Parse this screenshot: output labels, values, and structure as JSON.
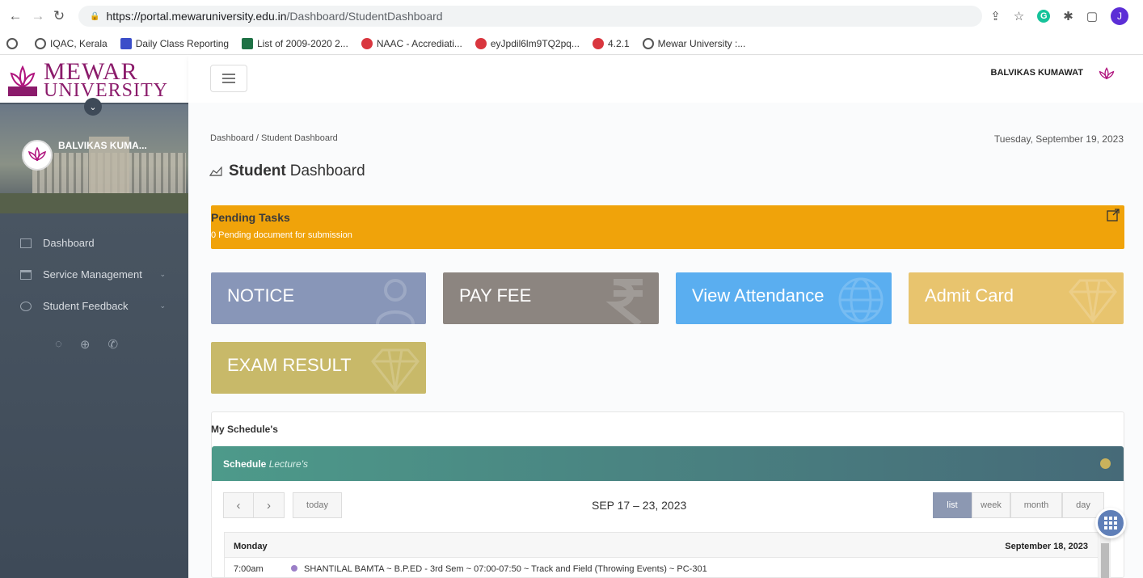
{
  "browser": {
    "url_host": "https://portal.mewaruniversity.edu.in",
    "url_path": "/Dashboard/StudentDashboard",
    "profile_initial": "J"
  },
  "bookmarks": [
    {
      "label": "IQAC, Kerala",
      "icon": "globe-icon"
    },
    {
      "label": "Daily Class Reporting",
      "icon": "list-icon"
    },
    {
      "label": "List of 2009-2020 2...",
      "icon": "excel-icon"
    },
    {
      "label": "NAAC - Accrediati...",
      "icon": "red-logo-icon"
    },
    {
      "label": "eyJpdil6lm9TQ2pq...",
      "icon": "red-logo-icon"
    },
    {
      "label": "4.2.1",
      "icon": "red-logo-icon"
    },
    {
      "label": "Mewar University :...",
      "icon": "globe-icon"
    }
  ],
  "sidebar": {
    "logo_line1": "MEWAR",
    "logo_line2": "UNIVERSITY",
    "user_name": "BALVIKAS KUMA...",
    "items": [
      {
        "label": "Dashboard"
      },
      {
        "label": "Service Management"
      },
      {
        "label": "Student Feedback"
      }
    ]
  },
  "header": {
    "user_name": "BALVIKAS KUMAWAT"
  },
  "breadcrumb": "Dashboard  /  Student Dashboard",
  "date": "Tuesday, September 19, 2023",
  "title": {
    "bold": "Student",
    "rest": "Dashboard"
  },
  "pending": {
    "title": "Pending Tasks",
    "subtitle": "0 Pending document for submission"
  },
  "tiles": {
    "notice": "NOTICE",
    "pay_fee": "PAY FEE",
    "attendance": "View Attendance",
    "admit": "Admit Card",
    "exam": "EXAM RESULT"
  },
  "schedule": {
    "card_title": "My Schedule's",
    "head_bold": "Schedule",
    "head_italic": "Lecture's",
    "today_label": "today",
    "range": "SEP 17 – 23, 2023",
    "views": [
      "list",
      "week",
      "month",
      "day"
    ],
    "day_name": "Monday",
    "day_date": "September 18, 2023",
    "event_time": "7:00am",
    "event_text": "SHANTILAL BAMTA ~ B.P.ED - 3rd Sem ~ 07:00-07:50 ~ Track and Field (Throwing Events) ~ PC-301"
  },
  "colors": {
    "pending": "#f0a30a",
    "notice": "#8896b8",
    "pay_fee": "#8c8580",
    "attendance": "#5aaef0",
    "admit": "#e8c46e",
    "exam": "#c8b969"
  }
}
